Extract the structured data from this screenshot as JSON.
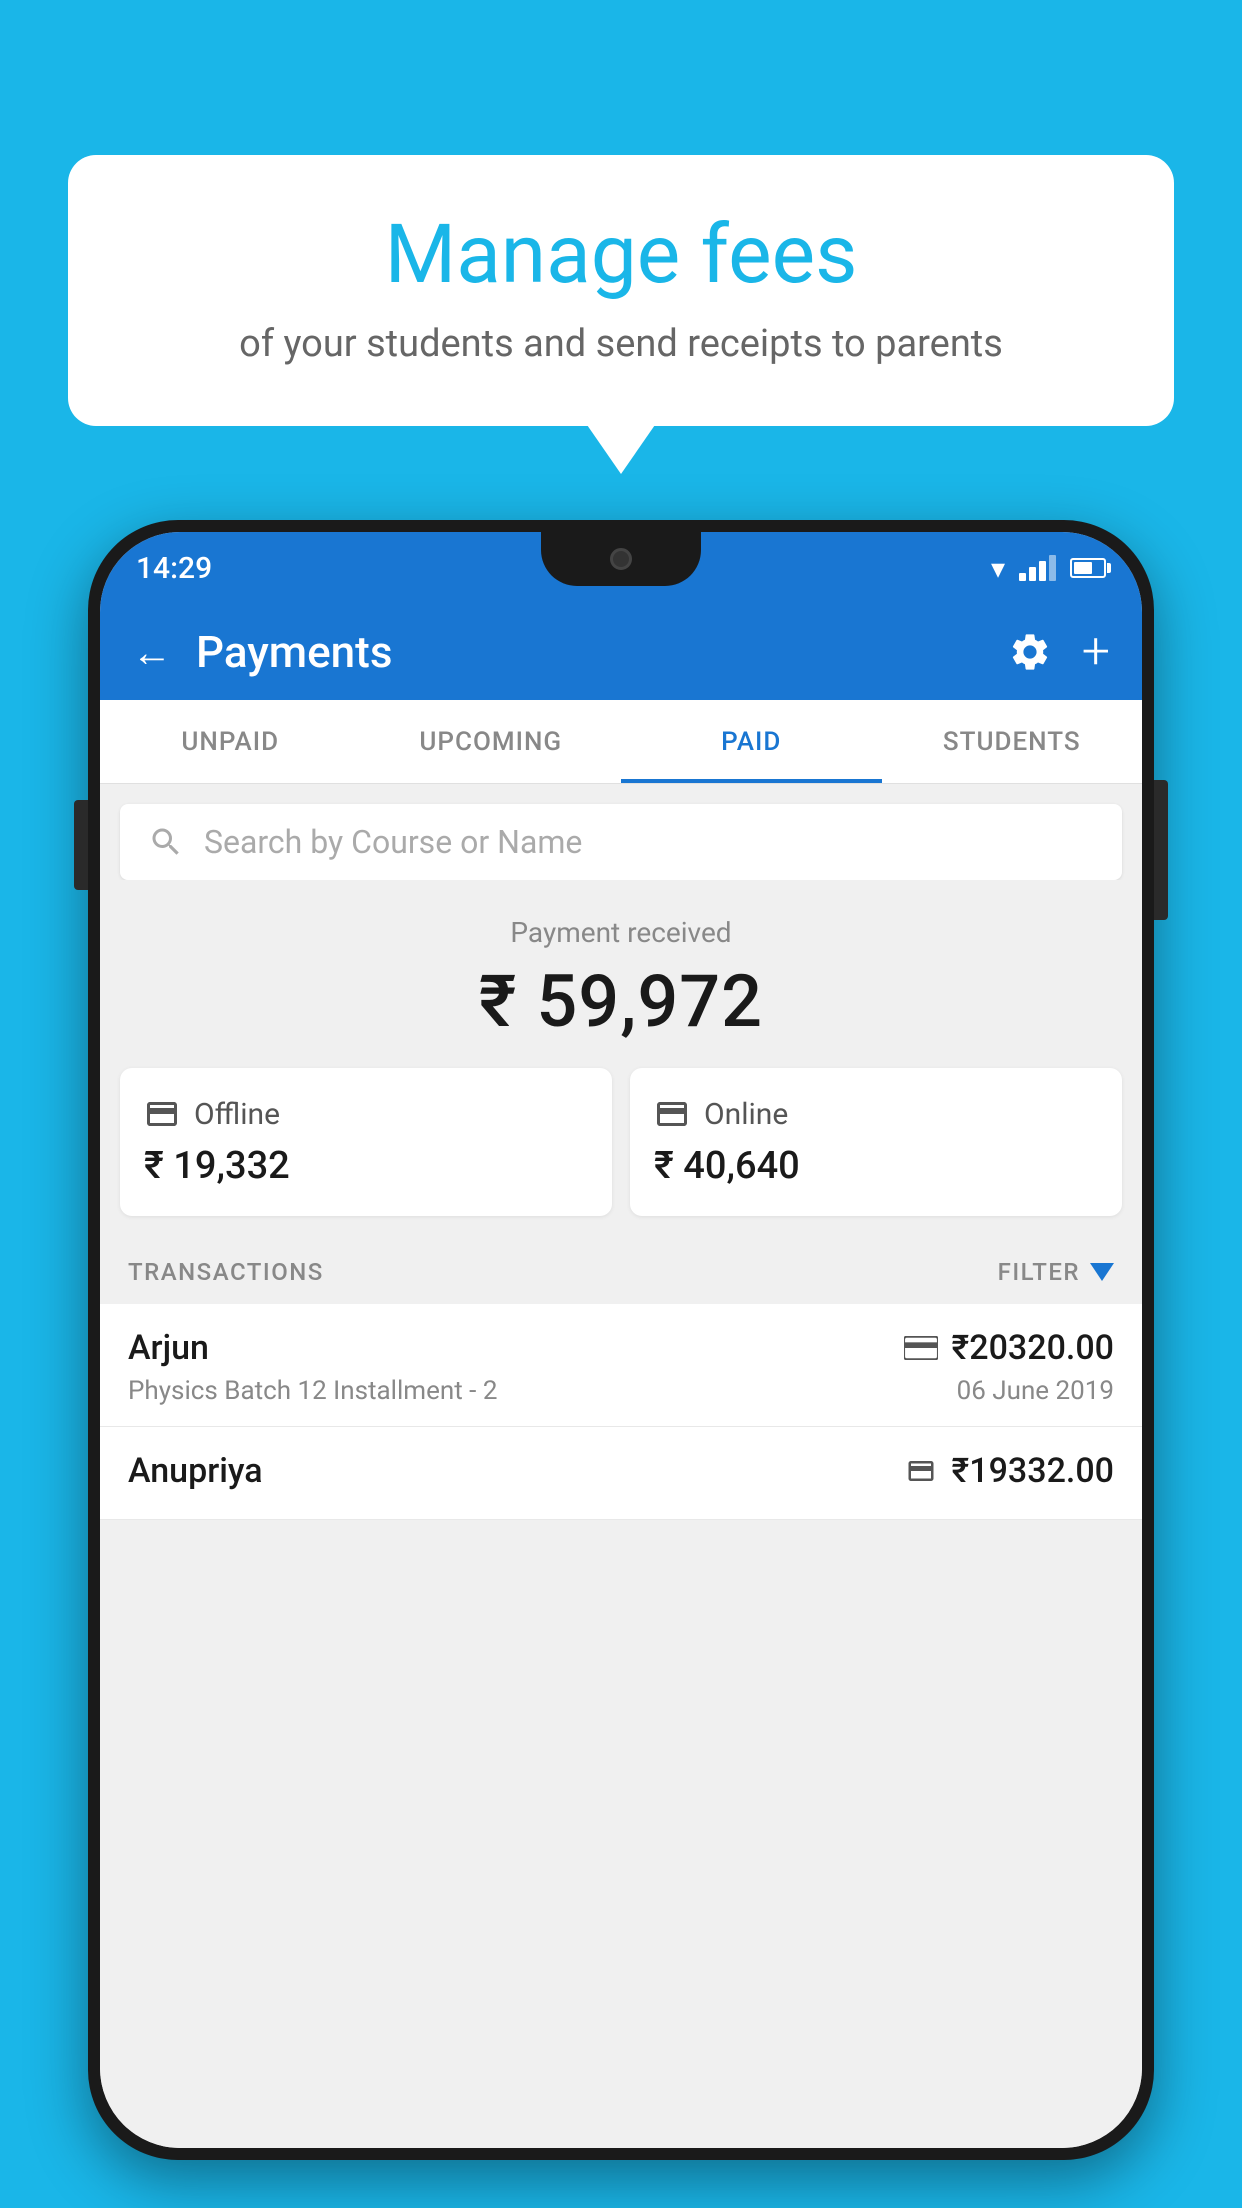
{
  "background_color": "#1ab6e8",
  "speech_bubble": {
    "title": "Manage fees",
    "subtitle": "of your students and send receipts to parents"
  },
  "status_bar": {
    "time": "14:29"
  },
  "app_bar": {
    "title": "Payments",
    "back_label": "←",
    "plus_label": "+"
  },
  "tabs": [
    {
      "id": "unpaid",
      "label": "UNPAID",
      "active": false
    },
    {
      "id": "upcoming",
      "label": "UPCOMING",
      "active": false
    },
    {
      "id": "paid",
      "label": "PAID",
      "active": true
    },
    {
      "id": "students",
      "label": "STUDENTS",
      "active": false
    }
  ],
  "search": {
    "placeholder": "Search by Course or Name"
  },
  "payment_summary": {
    "label": "Payment received",
    "amount": "₹ 59,972",
    "offline": {
      "label": "Offline",
      "amount": "₹ 19,332"
    },
    "online": {
      "label": "Online",
      "amount": "₹ 40,640"
    }
  },
  "transactions_section": {
    "header": "TRANSACTIONS",
    "filter_label": "FILTER",
    "transactions": [
      {
        "name": "Arjun",
        "course": "Physics Batch 12 Installment - 2",
        "amount": "₹20320.00",
        "date": "06 June 2019",
        "payment_type": "card"
      },
      {
        "name": "Anupriya",
        "course": "",
        "amount": "₹19332.00",
        "date": "",
        "payment_type": "cash"
      }
    ]
  }
}
